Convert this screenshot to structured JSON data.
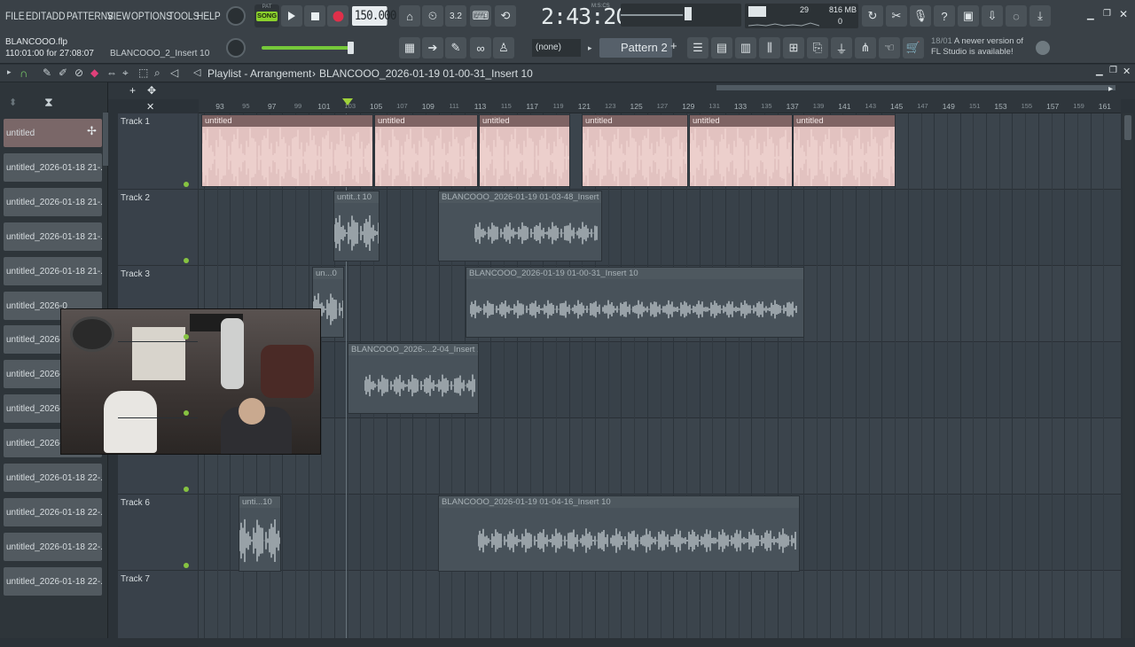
{
  "menu": [
    "FILE",
    "EDIT",
    "ADD",
    "PATTERNS",
    "VIEW",
    "OPTIONS",
    "TOOLS",
    "HELP"
  ],
  "transport": {
    "mode_label": "SONG",
    "mode_pat_label": "PAT",
    "tempo": "150.000",
    "time": "2:43:20",
    "time_unit_label": "M:S:CS",
    "cpu": "29",
    "memory": "816 MB",
    "poly": "0"
  },
  "project": {
    "filename": "BLANCOOO.flp",
    "time_info": "110:01:00 for 27:08:07",
    "hint_text": "BLANCOOO_2_Insert 10"
  },
  "pattern": {
    "selector": "(none)",
    "name": "Pattern 2"
  },
  "notice": {
    "date": "18/01",
    "line1": "A newer version of",
    "line2": "FL Studio is available!"
  },
  "playlist": {
    "title": "Playlist - Arrangement",
    "breadcrumb": "BLANCOOO_2026-01-19 01-00-31_Insert 10"
  },
  "sidebar_items": [
    "untitled",
    "untitled_2026-01-18 21-...",
    "untitled_2026-01-18 21-...",
    "untitled_2026-01-18 21-...",
    "untitled_2026-01-18 21-...",
    "untitled_2026-0",
    "untitled_2026-0",
    "untitled_2026-0",
    "untitled_2026-0",
    "untitled_2026-01-18 22-...",
    "untitled_2026-01-18 22-...",
    "untitled_2026-01-18 22-...",
    "untitled_2026-01-18 22-...",
    "untitled_2026-01-18 22-..."
  ],
  "ruler_ticks": [
    "93",
    "95",
    "97",
    "99",
    "101",
    "103",
    "105",
    "107",
    "109",
    "111",
    "113",
    "115",
    "117",
    "119",
    "121",
    "123",
    "125",
    "127",
    "129",
    "131",
    "133",
    "135",
    "137",
    "139",
    "141",
    "143",
    "145",
    "147",
    "149",
    "151",
    "153",
    "155",
    "157",
    "159",
    "161"
  ],
  "tracks": [
    "Track 1",
    "Track 2",
    "Track 3",
    "",
    "",
    "Track 6",
    "Track 7"
  ],
  "clips": {
    "t1": [
      "untitled",
      "untitled",
      "untitled",
      "untitled",
      "untitled",
      "untitled"
    ],
    "t2a": "untit..t 10",
    "t2b": "BLANCOOO_2026-01-19 01-03-48_Insert 10",
    "t3a": "un...0",
    "t3b": "BLANCOOO_2026-01-19 01-00-31_Insert 10",
    "t4": "BLANCOOO_2026-...2-04_Insert 10",
    "t6a": "unti...10",
    "t6b": "BLANCOOO_2026-01-19 01-04-16_Insert 10"
  },
  "colors": {
    "accent_green": "#86c341",
    "record_red": "#e0304a",
    "clip_pink": "#e2c2c0",
    "magnet": "#7bd06a"
  }
}
